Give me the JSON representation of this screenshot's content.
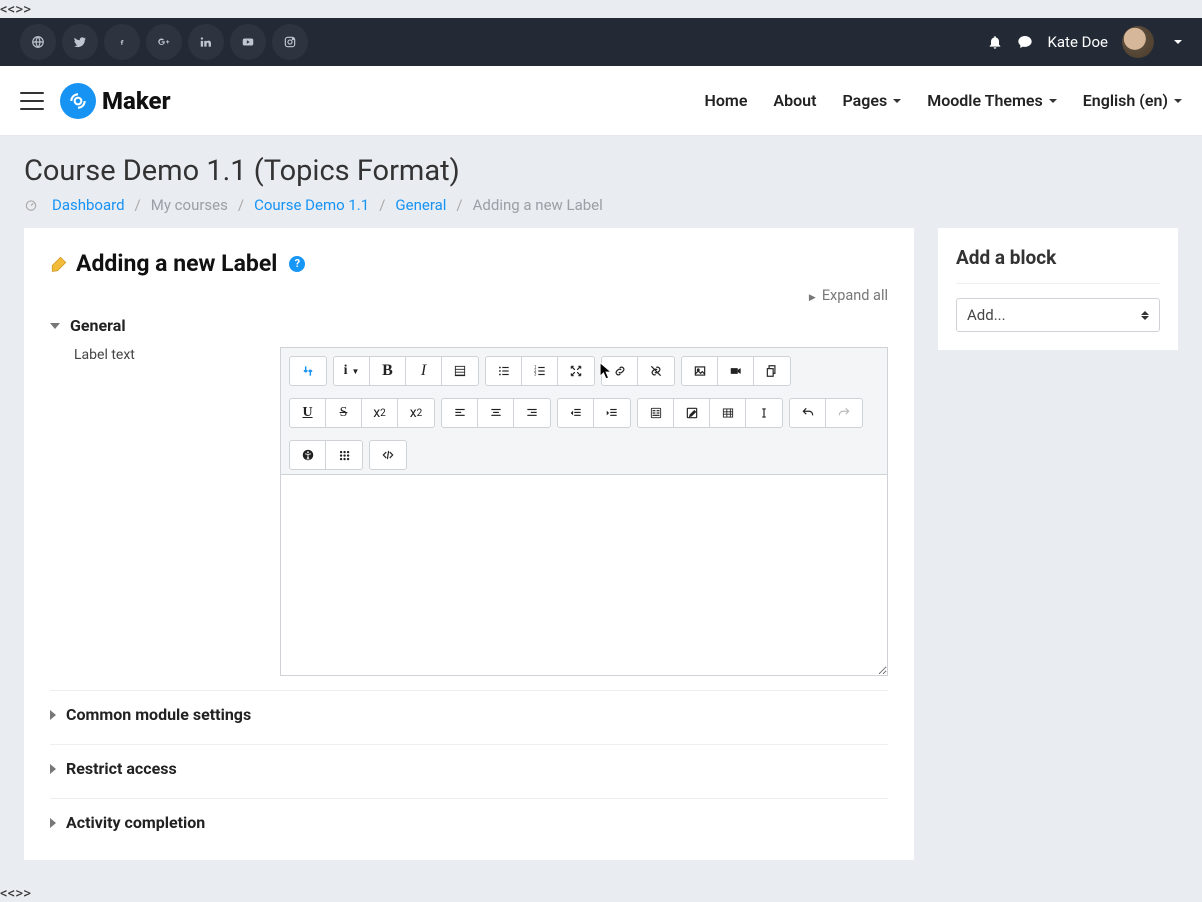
{
  "topbar": {
    "social_icons": [
      "globe-icon",
      "twitter-icon",
      "facebook-icon",
      "googleplus-icon",
      "linkedin-icon",
      "youtube-icon",
      "instagram-icon"
    ],
    "username": "Kate Doe"
  },
  "header": {
    "brand": "Maker",
    "nav": {
      "home": "Home",
      "about": "About",
      "pages": "Pages",
      "themes": "Moodle Themes",
      "language": "English (en)"
    }
  },
  "page": {
    "title": "Course Demo 1.1 (Topics Format)"
  },
  "breadcrumb": {
    "items": [
      {
        "label": "Dashboard",
        "link": true
      },
      {
        "label": "My courses",
        "link": false,
        "muted": true
      },
      {
        "label": "Course Demo 1.1",
        "link": true
      },
      {
        "label": "General",
        "link": true
      },
      {
        "label": "Adding a new Label",
        "link": false,
        "muted": true
      }
    ]
  },
  "main": {
    "heading": "Adding a new Label",
    "expand_all": "Expand all",
    "sections": {
      "general": "General",
      "label_text": "Label text",
      "common_module": "Common module settings",
      "restrict_access": "Restrict access",
      "activity_completion": "Activity completion"
    },
    "editor_value": ""
  },
  "sidebar": {
    "title": "Add a block",
    "select_placeholder": "Add..."
  }
}
